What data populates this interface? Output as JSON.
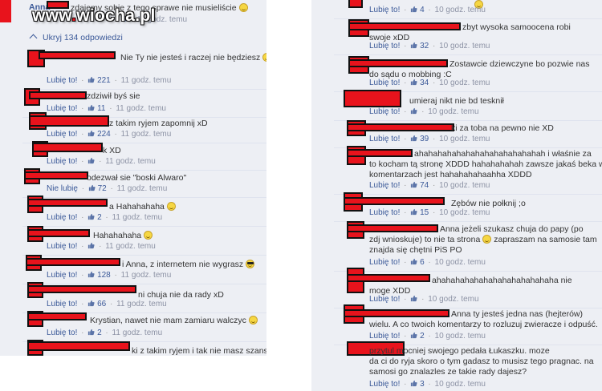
{
  "watermark": {
    "prefix": "www",
    "dot": ".",
    "name": "wiocha",
    "suffix": ".pl"
  },
  "top": {
    "name": "Anna",
    "text": "zdajemy sobie z tego sprawe nie musieliście",
    "time": "11 godz. temu",
    "count": "3"
  },
  "hide_replies": "Ukryj 134 odpowiedzi",
  "labels": {
    "like": "Lubię to!",
    "unlike": "Nie lubię"
  },
  "left_comments": [
    {
      "text": "Nie Ty nie jesteś i raczej nie będziesz",
      "emoji": true,
      "like": "Lubię to!",
      "count": "221",
      "time": "11 godz. temu"
    },
    {
      "text": "zdziwił byś sie",
      "like": "Lubię to!",
      "count": "11",
      "time": "11 godz. temu"
    },
    {
      "text": "z takim ryjem zapomnij xD",
      "like": "Lubię to!",
      "count": "224",
      "time": "11 godz. temu"
    },
    {
      "text": "k XD",
      "like": "Lubię to!",
      "count": "",
      "time": "11 godz. temu"
    },
    {
      "text": "odezwał sie \"boski Alwaro\"",
      "like": "Nie lubię",
      "count": "72",
      "time": "11 godz. temu"
    },
    {
      "text": "a Hahahahaha",
      "emoji": true,
      "like": "Lubię to!",
      "count": "2",
      "time": "11 godz. temu"
    },
    {
      "text": "Hahahahaha",
      "emoji": true,
      "like": "Lubię to!",
      "count": "",
      "time": "11 godz. temu"
    },
    {
      "text": "i Anna, z internetem nie wygrasz",
      "emoji": "cool",
      "like": "Lubię to!",
      "count": "128",
      "time": "11 godz. temu"
    },
    {
      "text": "ni chuja nie da rady xD",
      "like": "Lubię to!",
      "count": "66",
      "time": "11 godz. temu"
    },
    {
      "text": "Krystian, nawet nie mam zamiaru walczyc",
      "emoji": true,
      "like": "Lubię to!",
      "count": "2",
      "time": "11 godz. temu"
    },
    {
      "text": "ki z takim ryjem i tak nie masz szans",
      "like": "",
      "count": "",
      "time": ""
    }
  ],
  "right_comments": [
    {
      "text": "",
      "like": "Lubię to!",
      "count": "4",
      "time": "10 godz. temu",
      "emoji": true
    },
    {
      "text": "zbyt wysoka samoocena robi\nswoje xDD",
      "like": "Lubię to!",
      "count": "32",
      "time": "10 godz. temu"
    },
    {
      "text": "Zostawcie dziewczyne bo pozwie nas\ndo sądu o mobbing :C",
      "like": "Lubię to!",
      "count": "34",
      "time": "10 godz. temu"
    },
    {
      "text": "umieraj nikt nie bd tesknił",
      "like": "Lubię to!",
      "count": "",
      "time": "10 godz. temu"
    },
    {
      "text": "ki za toba na pewno nie XD",
      "like": "Lubię to!",
      "count": "39",
      "time": "10 godz. temu"
    },
    {
      "text": "ahahahahahahahahahahahahahah i właśnie za\nto kocham tą stronę XDDD hahahahahah zawsze jakaś beka w\nkomentarzach jest hahahahahaahha XDDD",
      "like": "Lubię to!",
      "count": "74",
      "time": "10 godz. temu"
    },
    {
      "text": "Zębów nie połknij ;o",
      "like": "Lubię to!",
      "count": "15",
      "time": "10 godz. temu"
    },
    {
      "text": "Anna jeżeli szukasz chuja do papy (po\nzdj wnioskuje) to nie ta strona",
      "text2": "zapraszam na samosie tam\nznajda się chętni PiS PO",
      "like": "Lubię to!",
      "count": "6",
      "time": "10 godz. temu"
    },
    {
      "text": "ahahahahahahahahahahahahaha nie\nmoge XDD",
      "like": "Lubię to!",
      "count": "",
      "time": "10 godz. temu"
    },
    {
      "text": "Anna ty jesteś jedna nas (hejterów)\nwielu. A co twoich komentarzy to rozluzuj zwieracze i odpuść.",
      "like": "Lubię to!",
      "count": "2",
      "time": "10 godz. temu"
    },
    {
      "text": "przytul mocniej swojego pedała Łukaszku. moze\nda ci do ryja skoro o tym gadasz to musisz tego pragnac. na\nsamosi go znalazles ze takie rady dajesz?",
      "like": "Lubię to!",
      "count": "3",
      "time": "10 godz. temu"
    }
  ],
  "colors": {
    "background": "#edeff4",
    "link": "#3b5998",
    "censor": "#e8131c"
  }
}
